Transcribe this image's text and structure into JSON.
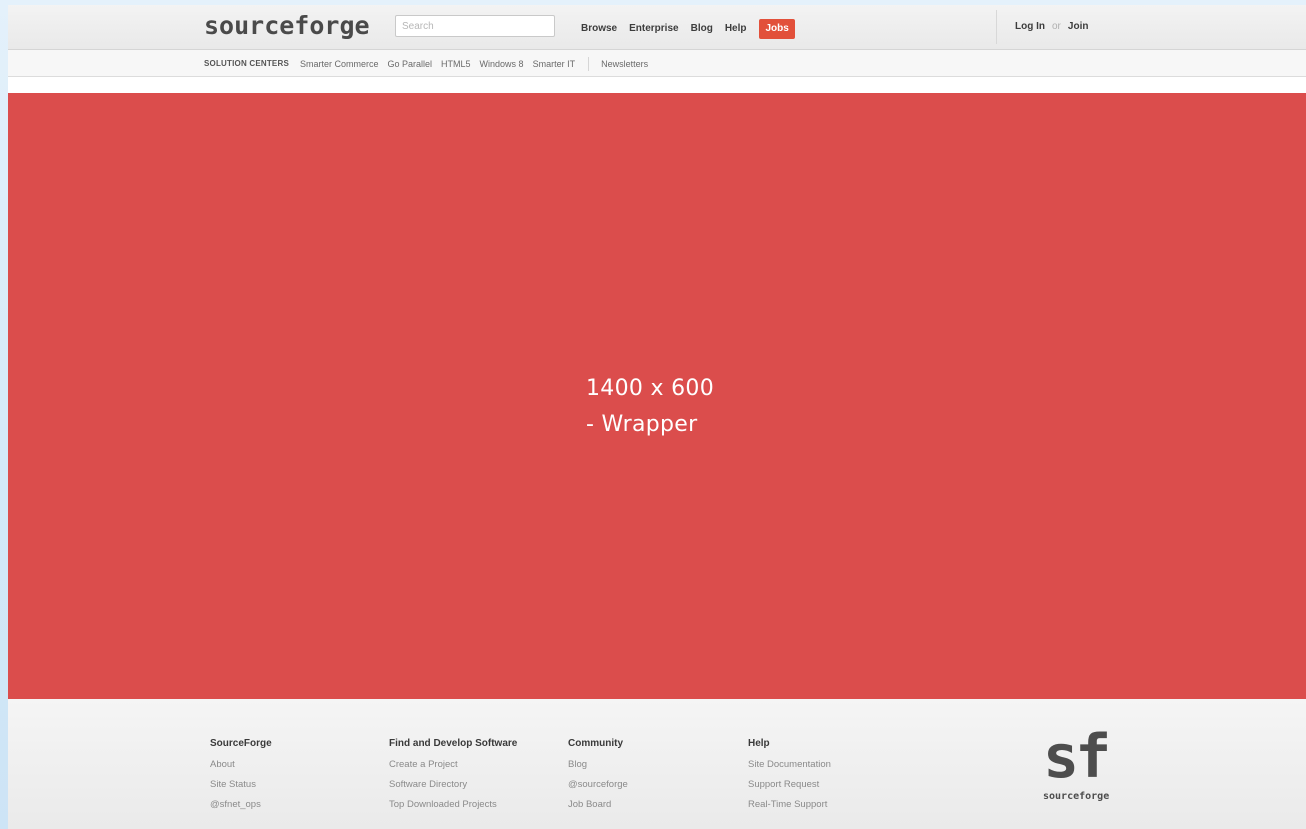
{
  "header": {
    "logo": "sourceforge",
    "search_placeholder": "Search",
    "nav": [
      "Browse",
      "Enterprise",
      "Blog",
      "Help"
    ],
    "jobs_label": "Jobs",
    "jobs_color": "#e2503a",
    "login": "Log In",
    "or": "or",
    "join": "Join"
  },
  "subnav": {
    "label": "SOLUTION CENTERS",
    "items": [
      "Smarter Commerce",
      "Go Parallel",
      "HTML5",
      "Windows 8",
      "Smarter IT"
    ],
    "newsletters": "Newsletters"
  },
  "hero": {
    "line1": "1400 x 600",
    "line2": "- Wrapper",
    "color": "#db4d4c"
  },
  "footer": {
    "columns": [
      {
        "heading": "SourceForge",
        "links": [
          "About",
          "Site Status",
          "@sfnet_ops"
        ]
      },
      {
        "heading": "Find and Develop Software",
        "links": [
          "Create a Project",
          "Software Directory",
          "Top Downloaded Projects"
        ]
      },
      {
        "heading": "Community",
        "links": [
          "Blog",
          "@sourceforge",
          "Job Board"
        ]
      },
      {
        "heading": "Help",
        "links": [
          "Site Documentation",
          "Support Request",
          "Real-Time Support"
        ]
      }
    ],
    "brand_mark": "sf",
    "brand_word": "sourceforge"
  }
}
